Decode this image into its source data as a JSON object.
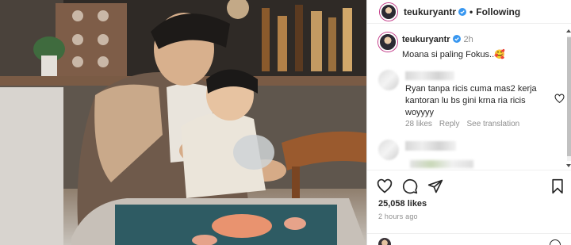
{
  "post": {
    "username": "teukuryantr",
    "separator": "•",
    "follow_label": "Following",
    "caption_username": "teukuryantr",
    "caption_time": "2h",
    "caption_text": "Moana si paling Fokus..🥰"
  },
  "comments": [
    {
      "text": "Ryan tanpa ricis cuma mas2 kerja kantoran lu bs gini krna ria ricis woyyyy",
      "likes_label": "28 likes",
      "reply_label": "Reply",
      "translation_label": "See translation"
    }
  ],
  "footer": {
    "likes_text": "25,058 likes",
    "posted_ago": "2 hours ago"
  },
  "icons": {
    "like": "heart-icon",
    "comment": "comment-icon",
    "share": "paper-plane-icon",
    "save": "bookmark-icon",
    "verified": "verified-badge-icon"
  },
  "colors": {
    "verified_blue": "#3897f0",
    "muted_text": "#8e8e8e",
    "primary_text": "#262626"
  }
}
